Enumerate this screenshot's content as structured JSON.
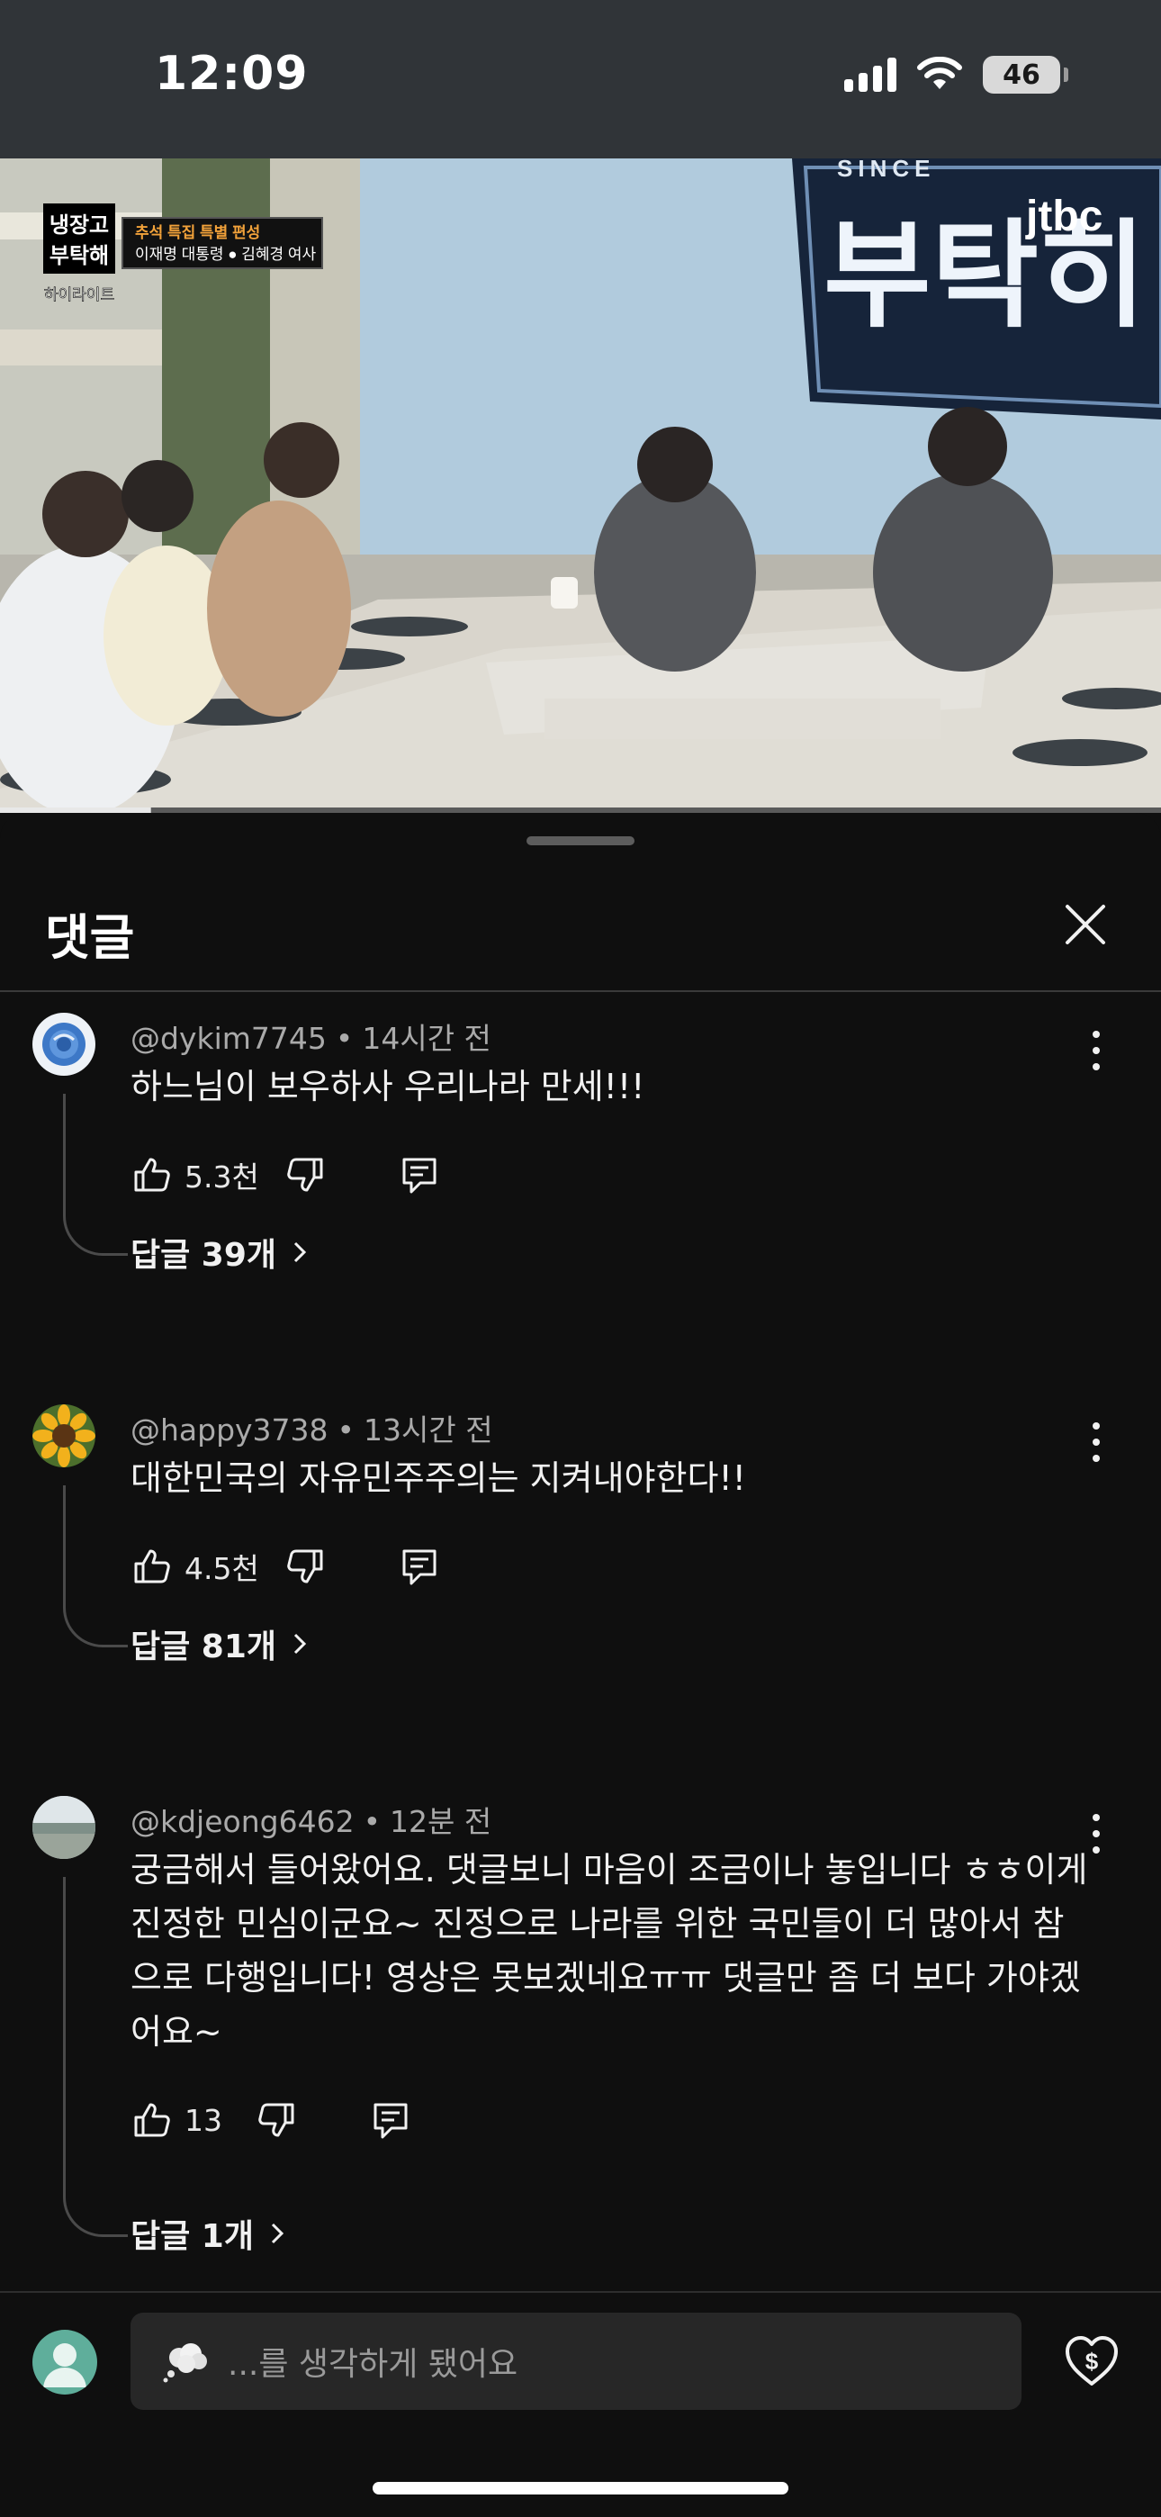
{
  "status_bar": {
    "time": "12:09",
    "battery": "46"
  },
  "video": {
    "show_logo_line1": "냉장고",
    "show_logo_line2": "부탁해",
    "banner_line1": "추석 특집 특별 편성",
    "banner_line2": "이재명 대통령 ● 김혜경 여사",
    "highlight_label": "하이라이트",
    "set_top_text": "SINCE ",
    "set_big_text": "부탁히",
    "channel_logo": "jtbc",
    "progress_fraction": 0.13
  },
  "panel": {
    "title": "댓글"
  },
  "comments": [
    {
      "author": "@dykim7745",
      "time": "14시간 전",
      "text": "하느님이 보우하사 우리나라 만세!!!",
      "likes": "5.3천",
      "replies": "답글 39개"
    },
    {
      "author": "@happy3738",
      "time": "13시간 전",
      "text": "대한민국의 자유민주주의는 지켜내야한다!!",
      "likes": "4.5천",
      "replies": "답글 81개"
    },
    {
      "author": "@kdjeong6462",
      "time": "12분 전",
      "text": "궁금해서 들어왔어요. 댓글보니 마음이 조금이나 놓입니다 ㅎㅎ이게 진정한 민심이군요~ 진정으로 나라를 위한 국민들이 더 많아서 참으로 다행입니다! 영상은 못보겠네요ㅠㅠ 댓글만 좀 더 보다 가야겠어요~",
      "likes": "13",
      "replies": "답글 1개"
    }
  ],
  "input": {
    "placeholder": "...를 생각하게 됐어요"
  },
  "colors": {
    "background": "#0f0f0f",
    "status_bar": "#303438",
    "input_bg": "#272727",
    "meta_text": "#aaaaaa"
  }
}
